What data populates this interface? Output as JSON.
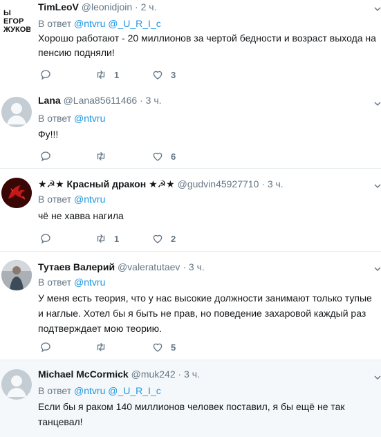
{
  "tweets": [
    {
      "name": "TimLeoV",
      "handle": "@leonidjoin",
      "time": "2 ч.",
      "reply_prefix": "В ответ",
      "mentions": [
        "@ntvru",
        "@_U_R_I_c"
      ],
      "text": "Хорошо работают - 20 миллионов за чертой бедности и возраст выхода на пенсию подняли!",
      "retweets": "1",
      "likes": "3",
      "avatar_text": [
        "Ы",
        "ЕГОР",
        "ЖУКОВ"
      ]
    },
    {
      "name": "Lana",
      "handle": "@Lana85611466",
      "time": "3 ч.",
      "reply_prefix": "В ответ",
      "mentions": [
        "@ntvru"
      ],
      "text": "Фу!!!",
      "retweets": "",
      "likes": "6"
    },
    {
      "name": "★☭★ Красный дракон ★☭★",
      "handle": "@gudvin45927710",
      "time": "3 ч.",
      "reply_prefix": "В ответ",
      "mentions": [
        "@ntvru"
      ],
      "text": "чё не хавва нагила",
      "retweets": "1",
      "likes": "2"
    },
    {
      "name": "Тутаев Валерий",
      "handle": "@valeratutaev",
      "time": "3 ч.",
      "reply_prefix": "В ответ",
      "mentions": [
        "@ntvru"
      ],
      "text": "У меня есть теория, что у нас высокие должности занимают только тупые и наглые. Хотел бы я быть не прав, но поведение захаровой каждый раз подтверждает мою теорию.",
      "retweets": "",
      "likes": "5"
    },
    {
      "name": "Michael McCormick",
      "handle": "@muk242",
      "time": "3 ч.",
      "reply_prefix": "В ответ",
      "mentions": [
        "@ntvru",
        "@_U_R_I_c"
      ],
      "text": "Если бы я раком 140 миллионов человек поставил, я бы ещё не так танцевал!"
    }
  ],
  "dot": "·",
  "icons": {
    "reply": "reply-icon",
    "retweet": "retweet-icon",
    "like": "heart-icon",
    "caret": "chevron-down-icon"
  },
  "colors": {
    "link": "#1b95e0",
    "muted": "#657786",
    "highlight_bg": "#f5f8fa"
  }
}
